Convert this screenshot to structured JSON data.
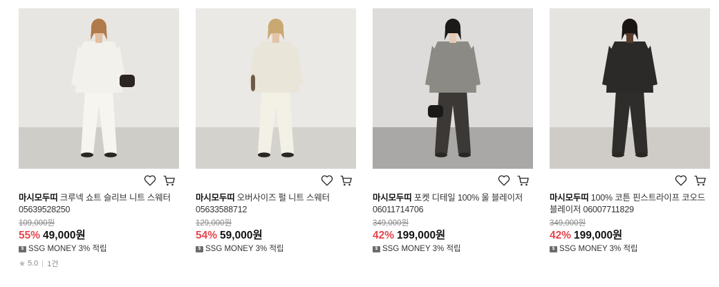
{
  "products": [
    {
      "brand": "마시모두띠",
      "name": " 크루넥 쇼트 슬리브 니트 스웨터 05639528250",
      "original_price": "109,000원",
      "discount": "55%",
      "price": "49,000원",
      "ssg_money": "SSG MONEY 3% 적립",
      "rating": "5.0",
      "review_count": "1건",
      "colors": {
        "bg_top": "#eeece8",
        "wall": "#e8e6e2",
        "floor": "#cfcdc8",
        "top": "#f2f1ec",
        "pants": "#f6f5f0",
        "hair": "#b07a4a",
        "skin": "#e2c0a3",
        "bag": "#2a2520"
      }
    },
    {
      "brand": "마시모두띠",
      "name": " 오버사이즈 펄 니트 스웨터 05633588712",
      "original_price": "129,000원",
      "discount": "54%",
      "price": "59,000원",
      "ssg_money": "SSG MONEY 3% 적립",
      "colors": {
        "bg_top": "#efede9",
        "wall": "#ebe9e5",
        "floor": "#d4d2cd",
        "top": "#e9e5d9",
        "pants": "#f3f0e6",
        "hair": "#c9a873",
        "skin": "#e3c4a8",
        "bag": "#6d5b4a"
      }
    },
    {
      "brand": "마시모두띠",
      "name": " 포켓 디테일 100% 울 블레이저 06011714706",
      "original_price": "349,000원",
      "discount": "42%",
      "price": "199,000원",
      "ssg_money": "SSG MONEY 3% 적립",
      "colors": {
        "bg_top": "#e3e2e0",
        "wall": "#dddcda",
        "floor": "#a9a8a6",
        "top": "#8b8a84",
        "pants": "#3b3835",
        "hair": "#1b1a19",
        "skin": "#e6cbb4",
        "bag": "#1a1918"
      }
    },
    {
      "brand": "마시모두띠",
      "name": " 100% 코튼 핀스트라이프 코오드 블레이저 06007711829",
      "original_price": "349,000원",
      "discount": "42%",
      "price": "199,000원",
      "ssg_money": "SSG MONEY 3% 적립",
      "colors": {
        "bg_top": "#ebe9e6",
        "wall": "#e6e4e1",
        "floor": "#cfccc8",
        "top": "#2b2a28",
        "pants": "#2e2d2b",
        "hair": "#1a1614",
        "skin": "#5a3d2e",
        "bag": "#2b2a28"
      }
    }
  ],
  "icons": {
    "wishlist": "heart-icon",
    "cart": "cart-icon",
    "star": "star-icon",
    "ssg": "ssg-money-icon"
  }
}
